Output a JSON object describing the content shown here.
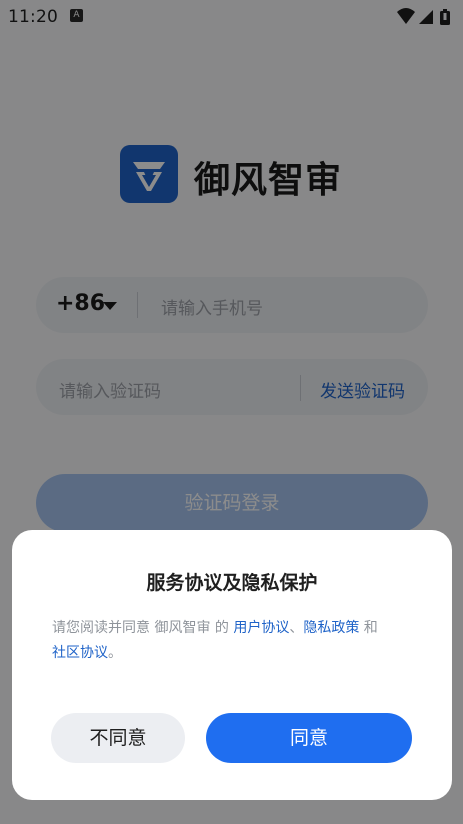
{
  "status_bar": {
    "time": "11:20",
    "notification_glyph": "A",
    "icons": [
      "wifi-icon",
      "signal-icon",
      "battery-icon"
    ]
  },
  "brand": {
    "app_name": "御风智审",
    "logo_color": "#1f63c8"
  },
  "login": {
    "country_code": "+86",
    "phone_placeholder": "请输入手机号",
    "code_placeholder": "请输入验证码",
    "send_code_label": "发送验证码",
    "login_button_label": "验证码登录"
  },
  "dialog": {
    "title": "服务协议及隐私保护",
    "body_prefix": "请您阅读并同意 御风智审 的 ",
    "user_agreement": "用户协议",
    "separator": "、",
    "privacy_policy": "隐私政策",
    "and": " 和",
    "community_agreement": "社区协议",
    "body_suffix": "。",
    "disagree_label": "不同意",
    "agree_label": "同意"
  },
  "colors": {
    "accent": "#1f6ef0",
    "link": "#1f63c8",
    "overlay": "rgba(0,0,0,0.45)"
  }
}
